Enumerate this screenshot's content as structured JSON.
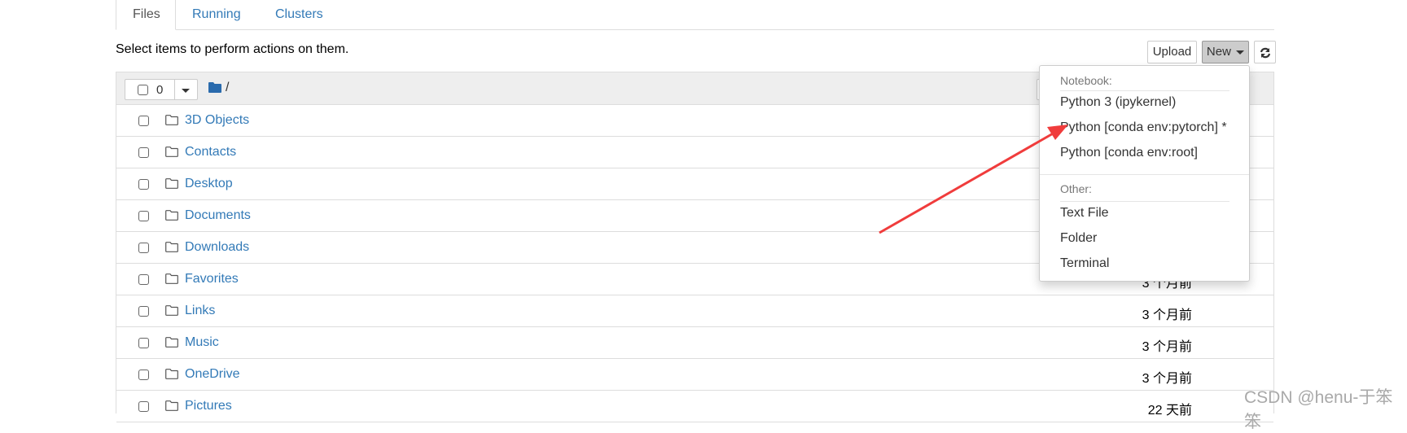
{
  "tabs": [
    {
      "label": "Files",
      "active": true
    },
    {
      "label": "Running"
    },
    {
      "label": "Clusters"
    }
  ],
  "hint": "Select items to perform actions on them.",
  "toolbar": {
    "upload_label": "Upload",
    "new_label": "New",
    "refresh_icon": "refresh-icon"
  },
  "header": {
    "selected_count": "0",
    "path": "/"
  },
  "rows": [
    {
      "name": "3D Objects"
    },
    {
      "name": "Contacts"
    },
    {
      "name": "Desktop"
    },
    {
      "name": "Documents"
    },
    {
      "name": "Downloads"
    },
    {
      "name": "Favorites",
      "date": "3 个月前"
    },
    {
      "name": "Links",
      "date": "3 个月前"
    },
    {
      "name": "Music",
      "date": "3 个月前"
    },
    {
      "name": "OneDrive",
      "date": "3 个月前"
    },
    {
      "name": "Pictures",
      "date": "22 天前"
    }
  ],
  "new_menu": {
    "notebook_header": "Notebook:",
    "notebook_items": [
      "Python 3 (ipykernel)",
      "Python [conda env:pytorch] *",
      "Python [conda env:root]"
    ],
    "other_header": "Other:",
    "other_items": [
      "Text File",
      "Folder",
      "Terminal"
    ]
  },
  "annotation_color": "#f03c3c",
  "watermark": "CSDN @henu-于笨笨"
}
